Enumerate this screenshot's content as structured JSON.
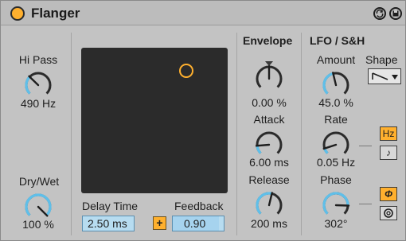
{
  "device": {
    "title": "Flanger",
    "icons": [
      "power-toggle-icon",
      "hot-swap-icon",
      "save-preset-icon"
    ]
  },
  "left": {
    "hipass_label": "Hi Pass",
    "hipass_value": "490 Hz",
    "hipass_level": 0.33,
    "drywet_label": "Dry/Wet",
    "drywet_value": "100 %",
    "drywet_level": 1.0
  },
  "center": {
    "delay_label": "Delay Time",
    "feedback_label": "Feedback",
    "delay_value": "2.50 ms",
    "link_label": "+",
    "feedback_value": "0.90",
    "feedback_level": 0.9,
    "xy_x": 0.72,
    "xy_y": 0.16
  },
  "envelope": {
    "header": "Envelope",
    "env_value": "0.00 %",
    "env_level": 0.5,
    "attack_label": "Attack",
    "attack_value": "6.00 ms",
    "attack_level": 0.15,
    "release_label": "Release",
    "release_value": "200 ms",
    "release_level": 0.55
  },
  "lfo": {
    "header": "LFO / S&H",
    "amount_label": "Amount",
    "amount_value": "45.0 %",
    "amount_level": 0.45,
    "shape_label": "Shape",
    "rate_label": "Rate",
    "rate_value": "0.05 Hz",
    "rate_level": 0.1,
    "hz_label": "Hz",
    "note_label": "♪",
    "phase_label": "Phase",
    "phase_value": "302°",
    "phase_level": 0.84,
    "phase_btn_label": "Φ",
    "spin_icon": "spin-mode-icon"
  },
  "colors": {
    "accent": "#ffb02e",
    "knob_arc": "#5fbfe9",
    "knob_track": "#2b2b2b",
    "xy_bg": "#2b2b2b"
  }
}
